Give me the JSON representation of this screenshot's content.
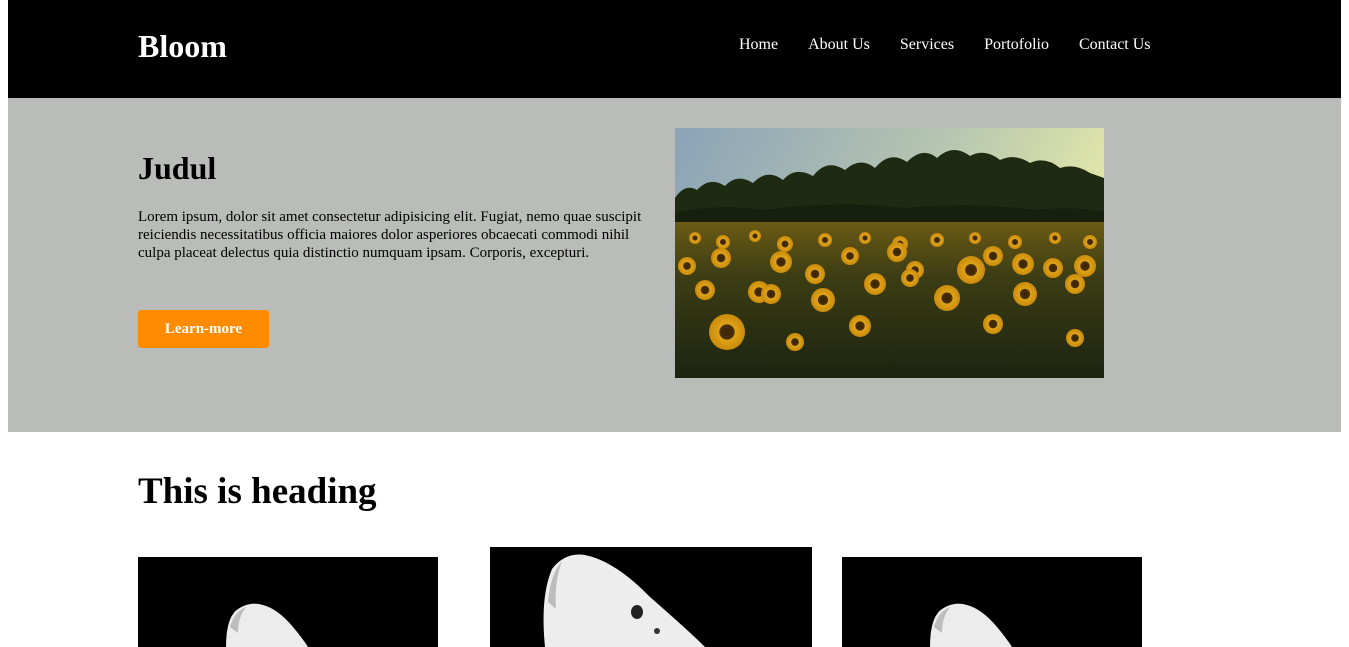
{
  "header": {
    "logo": "Bloom",
    "nav": [
      "Home",
      "About Us",
      "Services",
      "Portofolio",
      "Contact Us"
    ]
  },
  "hero": {
    "title": "Judul",
    "text": "Lorem ipsum, dolor sit amet consectetur adipisicing elit. Fugiat, nemo quae suscipit reiciendis necessitatibus officia maiores dolor asperiores obcaecati commodi nihil culpa placeat delectus quia distinctio numquam ipsam. Corporis, excepturi.",
    "button": "Learn-more",
    "image_icon": "sunflower-field-photo"
  },
  "section": {
    "heading": "This is heading",
    "cards": [
      {
        "image_icon": "white-device-photo"
      },
      {
        "image_icon": "white-device-photo"
      },
      {
        "image_icon": "white-device-photo"
      }
    ]
  },
  "colors": {
    "navbar": "#000000",
    "hero_bg": "#babcb9",
    "accent": "#ff8c00"
  }
}
